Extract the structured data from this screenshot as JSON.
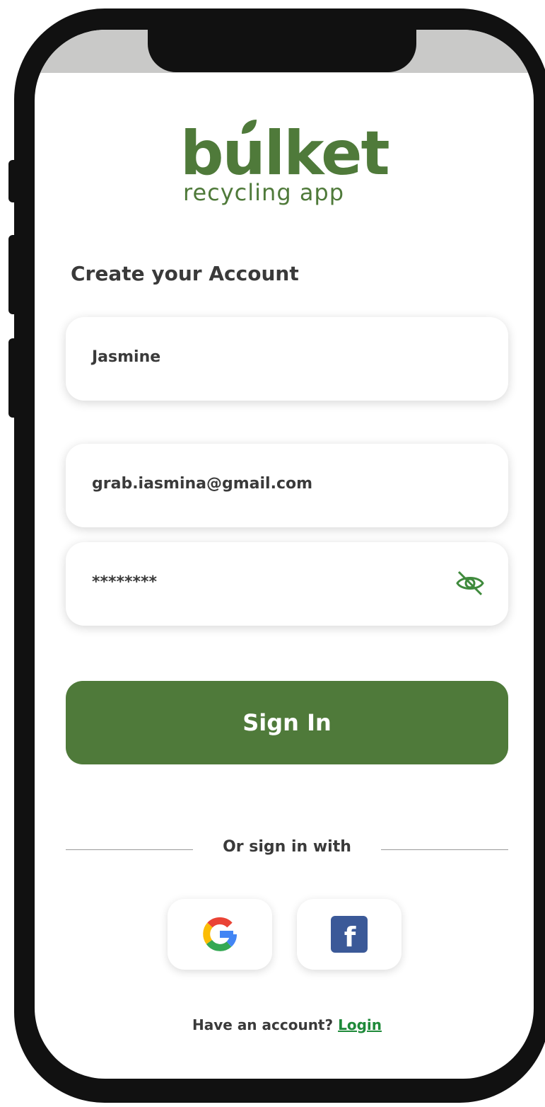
{
  "app": {
    "brand": "bulket",
    "tagline": "recycling app"
  },
  "form": {
    "title": "Create your Account",
    "name_value": "Jasmine",
    "email_value": "grab.iasmina@gmail.com",
    "password_value": "********",
    "submit_label": "Sign In"
  },
  "social": {
    "divider_label": "Or sign in with",
    "google_icon": "google-icon",
    "facebook_icon": "facebook-icon"
  },
  "footer": {
    "prompt": "Have an account?",
    "login_label": "Login"
  },
  "colors": {
    "brand_green": "#4f7a3a",
    "link_green": "#1f8a3a",
    "status_bar": "#c9c9c8",
    "text_dark": "#3a3a3a"
  }
}
